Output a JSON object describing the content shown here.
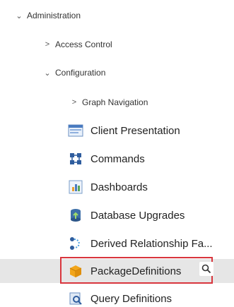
{
  "tree": {
    "administration": {
      "label": "Administration",
      "expanded": true
    },
    "access_control": {
      "label": "Access Control",
      "expanded": false
    },
    "configuration": {
      "label": "Configuration",
      "expanded": true
    },
    "graph_navigation": {
      "label": "Graph Navigation",
      "expanded": false
    },
    "items": [
      {
        "label": "Client Presentation",
        "icon": "client-presentation-icon"
      },
      {
        "label": "Commands",
        "icon": "commands-icon"
      },
      {
        "label": "Dashboards",
        "icon": "dashboards-icon"
      },
      {
        "label": "Database Upgrades",
        "icon": "database-upgrades-icon"
      },
      {
        "label": "Derived Relationship Fa...",
        "icon": "derived-relationship-icon"
      },
      {
        "label": "PackageDefinitions",
        "icon": "package-icon",
        "selected": true
      },
      {
        "label": "Query Definitions",
        "icon": "query-definitions-icon"
      }
    ]
  },
  "colors": {
    "selection_background": "#e6e6e6",
    "highlight_border": "#d9363e",
    "package_icon": "#f2a51a"
  }
}
